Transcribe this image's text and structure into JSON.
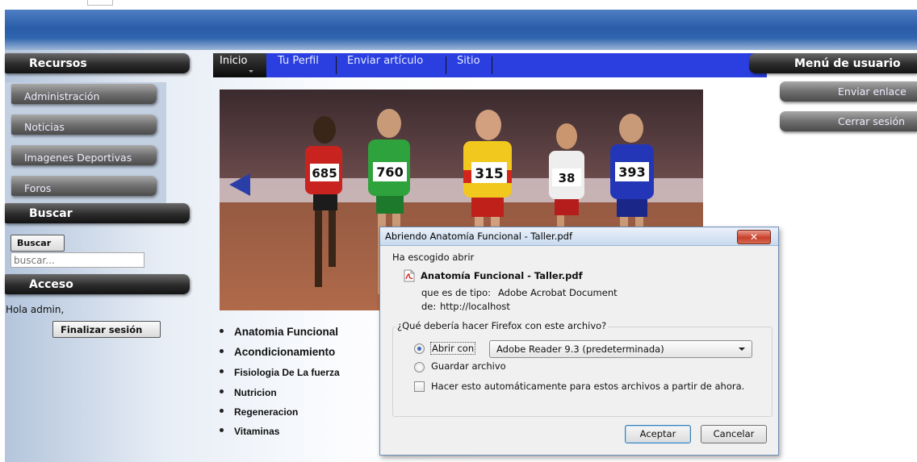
{
  "sidebar": {
    "resources_header": "Recursos",
    "items": [
      {
        "label": "Administración"
      },
      {
        "label": "Noticias"
      },
      {
        "label": "Imagenes Deportivas"
      },
      {
        "label": "Foros"
      }
    ],
    "search_header": "Buscar",
    "search_button": "Buscar",
    "search_placeholder": "buscar...",
    "access_header": "Acceso",
    "greeting": "Hola admin,",
    "logout_button": "Finalizar sesión"
  },
  "nav": {
    "tabs": [
      {
        "label": "Inicio",
        "active": true
      },
      {
        "label": "Tu Perfil",
        "active": false
      },
      {
        "label": "Enviar artículo",
        "active": false
      },
      {
        "label": "Sitio",
        "active": false
      }
    ]
  },
  "content": {
    "photo_bibs": [
      "685",
      "760",
      "315",
      "38",
      "393"
    ],
    "categories": [
      "Anatomia Funcional",
      "Acondicionamiento",
      "Fisiologia De La fuerza",
      "Nutricion",
      "Regeneracion",
      "Vitaminas"
    ]
  },
  "user_menu": {
    "header": "Menú de usuario",
    "items": [
      {
        "label": "Enviar enlace"
      },
      {
        "label": "Cerrar sesión"
      }
    ]
  },
  "dialog": {
    "title": "Abriendo Anatomía Funcional - Taller.pdf",
    "intro": "Ha escogido abrir",
    "file_name": "Anatomía Funcional - Taller.pdf",
    "type_label": "que es de tipo:",
    "type_value": "Adobe Acrobat Document",
    "from_label": "de:",
    "from_value": "http://localhost",
    "question": "¿Qué debería hacer Firefox con este archivo?",
    "open_with_label": "Abrir con",
    "open_with_app": "Adobe Reader 9.3 (predeterminada)",
    "save_label": "Guardar archivo",
    "auto_label": "Hacer esto automáticamente para estos archivos a partir de ahora.",
    "accept_button": "Aceptar",
    "cancel_button": "Cancelar",
    "close_glyph": "✕"
  },
  "colors": {
    "banner": "#2a5da8",
    "nav_bar": "#2b3fe0",
    "nav_active": "#0a0a0a",
    "header_dark": "#1e1e1e"
  }
}
